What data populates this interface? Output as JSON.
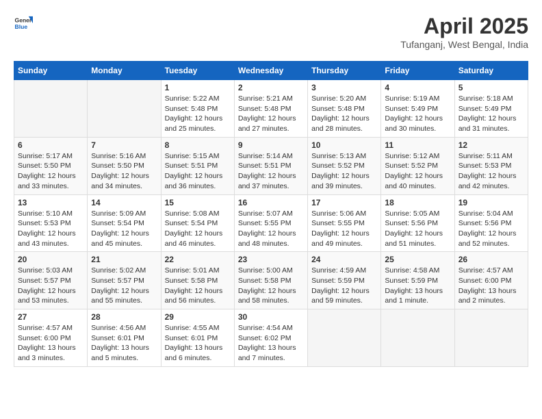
{
  "header": {
    "logo_general": "General",
    "logo_blue": "Blue",
    "title": "April 2025",
    "location": "Tufanganj, West Bengal, India"
  },
  "calendar": {
    "days_of_week": [
      "Sunday",
      "Monday",
      "Tuesday",
      "Wednesday",
      "Thursday",
      "Friday",
      "Saturday"
    ],
    "weeks": [
      [
        {
          "day": "",
          "info": ""
        },
        {
          "day": "",
          "info": ""
        },
        {
          "day": "1",
          "info": "Sunrise: 5:22 AM\nSunset: 5:48 PM\nDaylight: 12 hours\nand 25 minutes."
        },
        {
          "day": "2",
          "info": "Sunrise: 5:21 AM\nSunset: 5:48 PM\nDaylight: 12 hours\nand 27 minutes."
        },
        {
          "day": "3",
          "info": "Sunrise: 5:20 AM\nSunset: 5:48 PM\nDaylight: 12 hours\nand 28 minutes."
        },
        {
          "day": "4",
          "info": "Sunrise: 5:19 AM\nSunset: 5:49 PM\nDaylight: 12 hours\nand 30 minutes."
        },
        {
          "day": "5",
          "info": "Sunrise: 5:18 AM\nSunset: 5:49 PM\nDaylight: 12 hours\nand 31 minutes."
        }
      ],
      [
        {
          "day": "6",
          "info": "Sunrise: 5:17 AM\nSunset: 5:50 PM\nDaylight: 12 hours\nand 33 minutes."
        },
        {
          "day": "7",
          "info": "Sunrise: 5:16 AM\nSunset: 5:50 PM\nDaylight: 12 hours\nand 34 minutes."
        },
        {
          "day": "8",
          "info": "Sunrise: 5:15 AM\nSunset: 5:51 PM\nDaylight: 12 hours\nand 36 minutes."
        },
        {
          "day": "9",
          "info": "Sunrise: 5:14 AM\nSunset: 5:51 PM\nDaylight: 12 hours\nand 37 minutes."
        },
        {
          "day": "10",
          "info": "Sunrise: 5:13 AM\nSunset: 5:52 PM\nDaylight: 12 hours\nand 39 minutes."
        },
        {
          "day": "11",
          "info": "Sunrise: 5:12 AM\nSunset: 5:52 PM\nDaylight: 12 hours\nand 40 minutes."
        },
        {
          "day": "12",
          "info": "Sunrise: 5:11 AM\nSunset: 5:53 PM\nDaylight: 12 hours\nand 42 minutes."
        }
      ],
      [
        {
          "day": "13",
          "info": "Sunrise: 5:10 AM\nSunset: 5:53 PM\nDaylight: 12 hours\nand 43 minutes."
        },
        {
          "day": "14",
          "info": "Sunrise: 5:09 AM\nSunset: 5:54 PM\nDaylight: 12 hours\nand 45 minutes."
        },
        {
          "day": "15",
          "info": "Sunrise: 5:08 AM\nSunset: 5:54 PM\nDaylight: 12 hours\nand 46 minutes."
        },
        {
          "day": "16",
          "info": "Sunrise: 5:07 AM\nSunset: 5:55 PM\nDaylight: 12 hours\nand 48 minutes."
        },
        {
          "day": "17",
          "info": "Sunrise: 5:06 AM\nSunset: 5:55 PM\nDaylight: 12 hours\nand 49 minutes."
        },
        {
          "day": "18",
          "info": "Sunrise: 5:05 AM\nSunset: 5:56 PM\nDaylight: 12 hours\nand 51 minutes."
        },
        {
          "day": "19",
          "info": "Sunrise: 5:04 AM\nSunset: 5:56 PM\nDaylight: 12 hours\nand 52 minutes."
        }
      ],
      [
        {
          "day": "20",
          "info": "Sunrise: 5:03 AM\nSunset: 5:57 PM\nDaylight: 12 hours\nand 53 minutes."
        },
        {
          "day": "21",
          "info": "Sunrise: 5:02 AM\nSunset: 5:57 PM\nDaylight: 12 hours\nand 55 minutes."
        },
        {
          "day": "22",
          "info": "Sunrise: 5:01 AM\nSunset: 5:58 PM\nDaylight: 12 hours\nand 56 minutes."
        },
        {
          "day": "23",
          "info": "Sunrise: 5:00 AM\nSunset: 5:58 PM\nDaylight: 12 hours\nand 58 minutes."
        },
        {
          "day": "24",
          "info": "Sunrise: 4:59 AM\nSunset: 5:59 PM\nDaylight: 12 hours\nand 59 minutes."
        },
        {
          "day": "25",
          "info": "Sunrise: 4:58 AM\nSunset: 5:59 PM\nDaylight: 13 hours\nand 1 minute."
        },
        {
          "day": "26",
          "info": "Sunrise: 4:57 AM\nSunset: 6:00 PM\nDaylight: 13 hours\nand 2 minutes."
        }
      ],
      [
        {
          "day": "27",
          "info": "Sunrise: 4:57 AM\nSunset: 6:00 PM\nDaylight: 13 hours\nand 3 minutes."
        },
        {
          "day": "28",
          "info": "Sunrise: 4:56 AM\nSunset: 6:01 PM\nDaylight: 13 hours\nand 5 minutes."
        },
        {
          "day": "29",
          "info": "Sunrise: 4:55 AM\nSunset: 6:01 PM\nDaylight: 13 hours\nand 6 minutes."
        },
        {
          "day": "30",
          "info": "Sunrise: 4:54 AM\nSunset: 6:02 PM\nDaylight: 13 hours\nand 7 minutes."
        },
        {
          "day": "",
          "info": ""
        },
        {
          "day": "",
          "info": ""
        },
        {
          "day": "",
          "info": ""
        }
      ]
    ]
  }
}
